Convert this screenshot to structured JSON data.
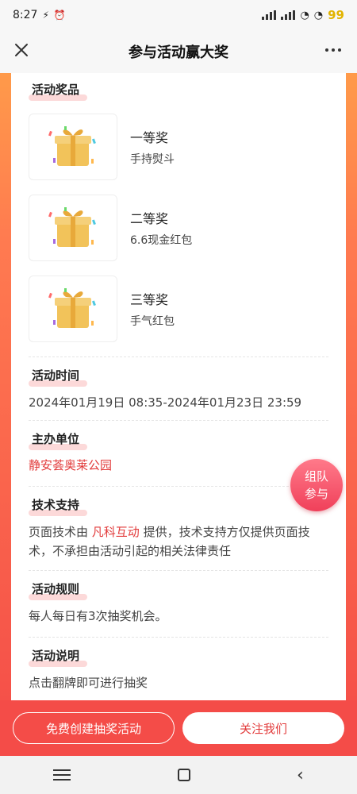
{
  "status": {
    "time": "8:27",
    "battery": "99"
  },
  "header": {
    "title": "参与活动赢大奖"
  },
  "prizes_section": {
    "title": "活动奖品",
    "items": [
      {
        "level": "一等奖",
        "name": "手持熨斗"
      },
      {
        "level": "二等奖",
        "name": "6.6现金红包"
      },
      {
        "level": "三等奖",
        "name": "手气红包"
      }
    ]
  },
  "time_section": {
    "title": "活动时间",
    "value": "2024年01月19日 08:35-2024年01月23日 23:59"
  },
  "organizer_section": {
    "title": "主办单位",
    "value": "静安荟奥莱公园"
  },
  "tech_section": {
    "title": "技术支持",
    "prefix": "页面技术由",
    "company": "凡科互动",
    "suffix": "提供，技术支持方仅提供页面技术，不承担由活动引起的相关法律责任"
  },
  "rules_section": {
    "title": "活动规则",
    "value": "每人每日有3次抽奖机会。"
  },
  "desc_section": {
    "title": "活动说明",
    "value": "点击翻牌即可进行抽奖"
  },
  "team_button": {
    "line1": "组队",
    "line2": "参与"
  },
  "bottom": {
    "create_label": "免费创建抽奖活动",
    "follow_label": "关注我们"
  },
  "colors": {
    "accent": "#e23b3b",
    "bg_top": "#ff9a4a",
    "bg_bottom": "#f44c48"
  }
}
